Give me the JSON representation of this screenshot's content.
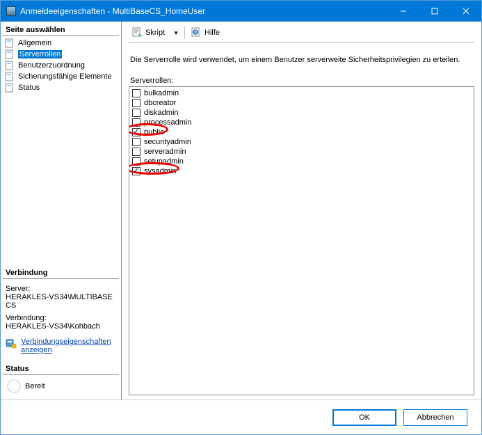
{
  "window": {
    "title": "Anmeldeeigenschaften - MultiBaseCS_HomeUser"
  },
  "sidebar": {
    "select_page": "Seite auswählen",
    "items": [
      {
        "label": "Allgemein"
      },
      {
        "label": "Serverrollen"
      },
      {
        "label": "Benutzerzuordnung"
      },
      {
        "label": "Sicherungsfähige Elemente"
      },
      {
        "label": "Status"
      }
    ],
    "connection": {
      "title": "Verbindung",
      "server_label": "Server:",
      "server_value": "HERAKLES-VS34\\MULTIBASECS",
      "conn_label": "Verbindung:",
      "conn_value": "HERAKLES-VS34\\Kohbach",
      "props_link": "Verbindungseigenschaften anzeigen"
    },
    "status": {
      "title": "Status",
      "text": "Bereit"
    }
  },
  "toolbar": {
    "script_label": "Skript",
    "help_label": "Hilfe"
  },
  "main": {
    "description": "Die Serverrolle wird verwendet, um einem Benutzer serverweite Sicherheitsprivilegien zu erteilen.",
    "list_label": "Serverrollen:",
    "roles": [
      {
        "name": "bulkadmin",
        "checked": false
      },
      {
        "name": "dbcreator",
        "checked": false
      },
      {
        "name": "diskadmin",
        "checked": false
      },
      {
        "name": "processadmin",
        "checked": false
      },
      {
        "name": "public",
        "checked": true
      },
      {
        "name": "securityadmin",
        "checked": false
      },
      {
        "name": "serveradmin",
        "checked": false
      },
      {
        "name": "setupadmin",
        "checked": false
      },
      {
        "name": "sysadmin",
        "checked": true
      }
    ]
  },
  "footer": {
    "ok": "OK",
    "cancel": "Abbrechen"
  }
}
